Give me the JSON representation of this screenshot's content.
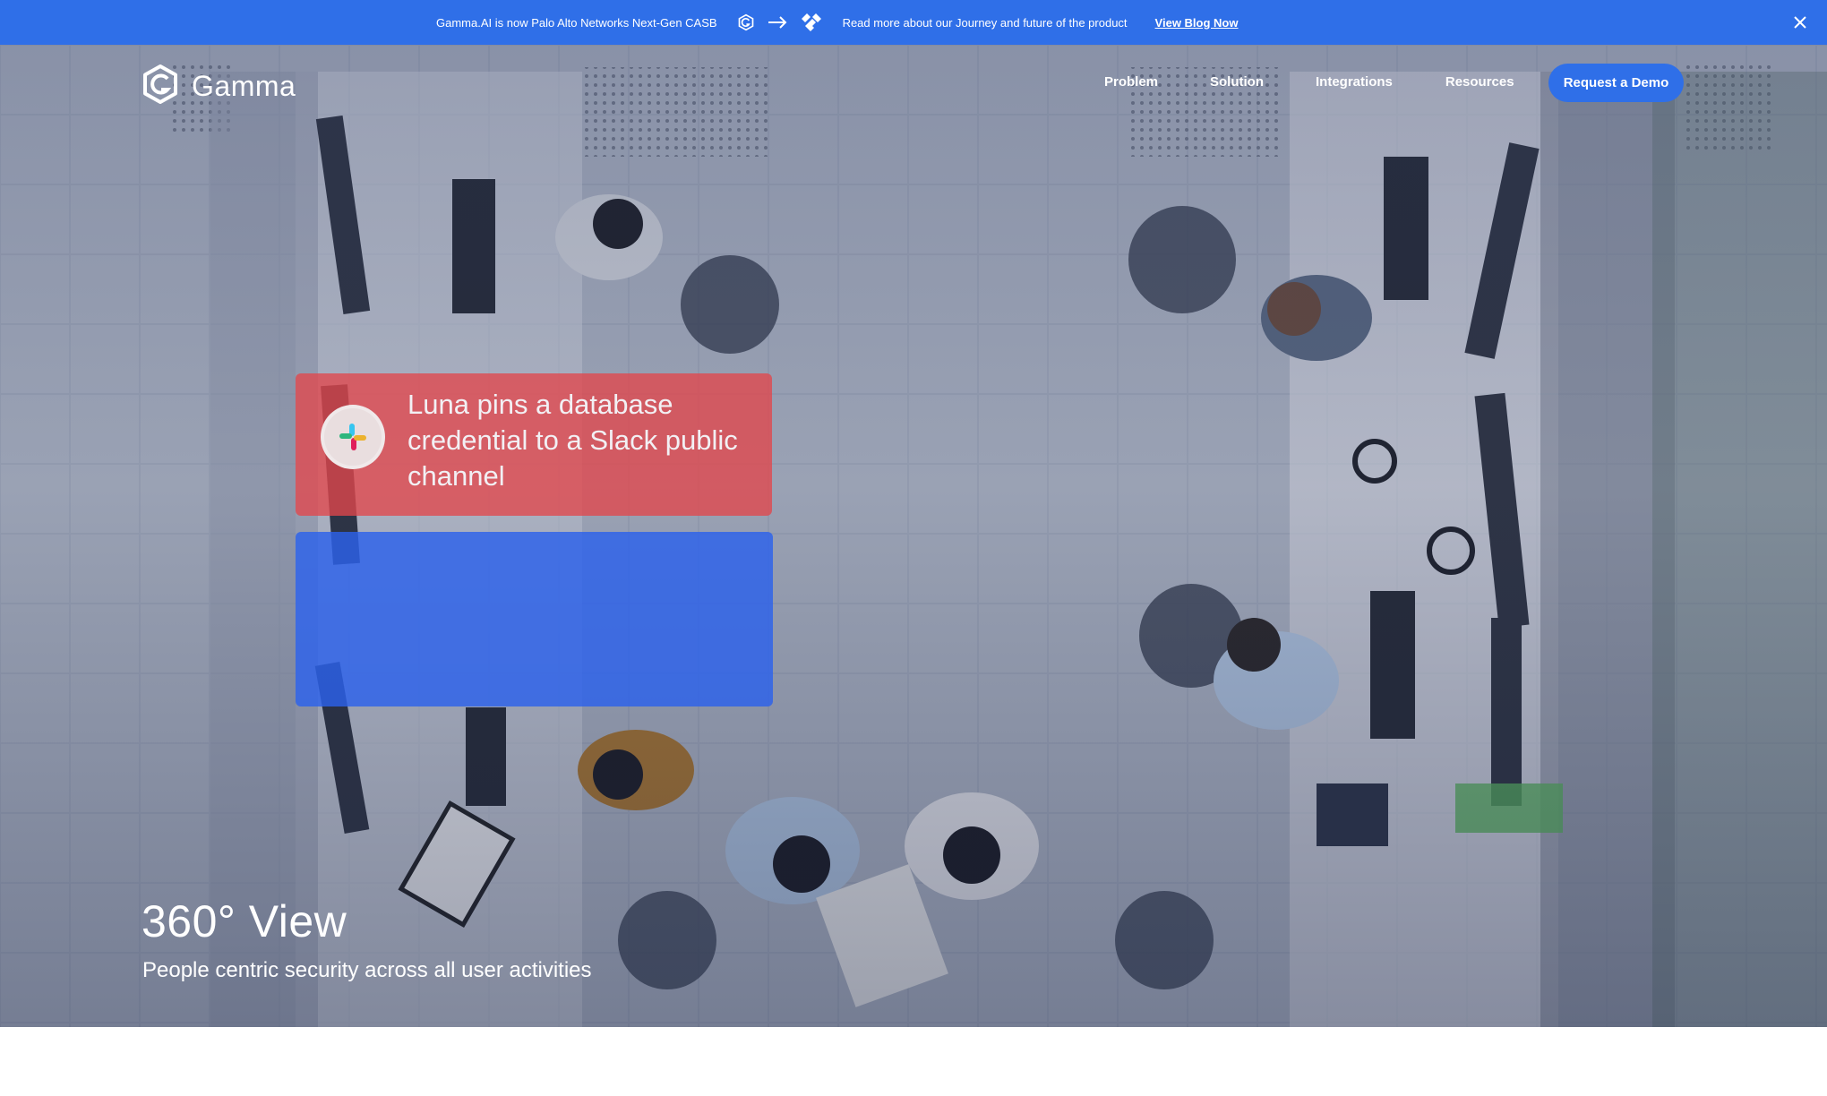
{
  "announcement": {
    "message": "Gamma.AI is now Palo Alto Networks Next-Gen CASB",
    "read_more": "Read more about our Journey and future of the product",
    "link_label": "View Blog Now",
    "icons": [
      "gamma-logo-icon",
      "arrow-right-icon",
      "palo-alto-logo-icon",
      "close-icon"
    ],
    "background": "#2f6fe8"
  },
  "header": {
    "brand": "Gamma",
    "nav": {
      "problem": "Problem",
      "solution": "Solution",
      "integrations": "Integrations",
      "resources": "Resources"
    },
    "cta": "Request a Demo",
    "accent": "#2f6fe8"
  },
  "hero": {
    "alert_card": {
      "icon": "slack-icon",
      "text": "Luna pins a database credential to a Slack public channel",
      "color": "#e1464b"
    },
    "second_card": {
      "color": "#2c62eb"
    },
    "title": "360° View",
    "subtitle": "People centric security across all user activities"
  }
}
